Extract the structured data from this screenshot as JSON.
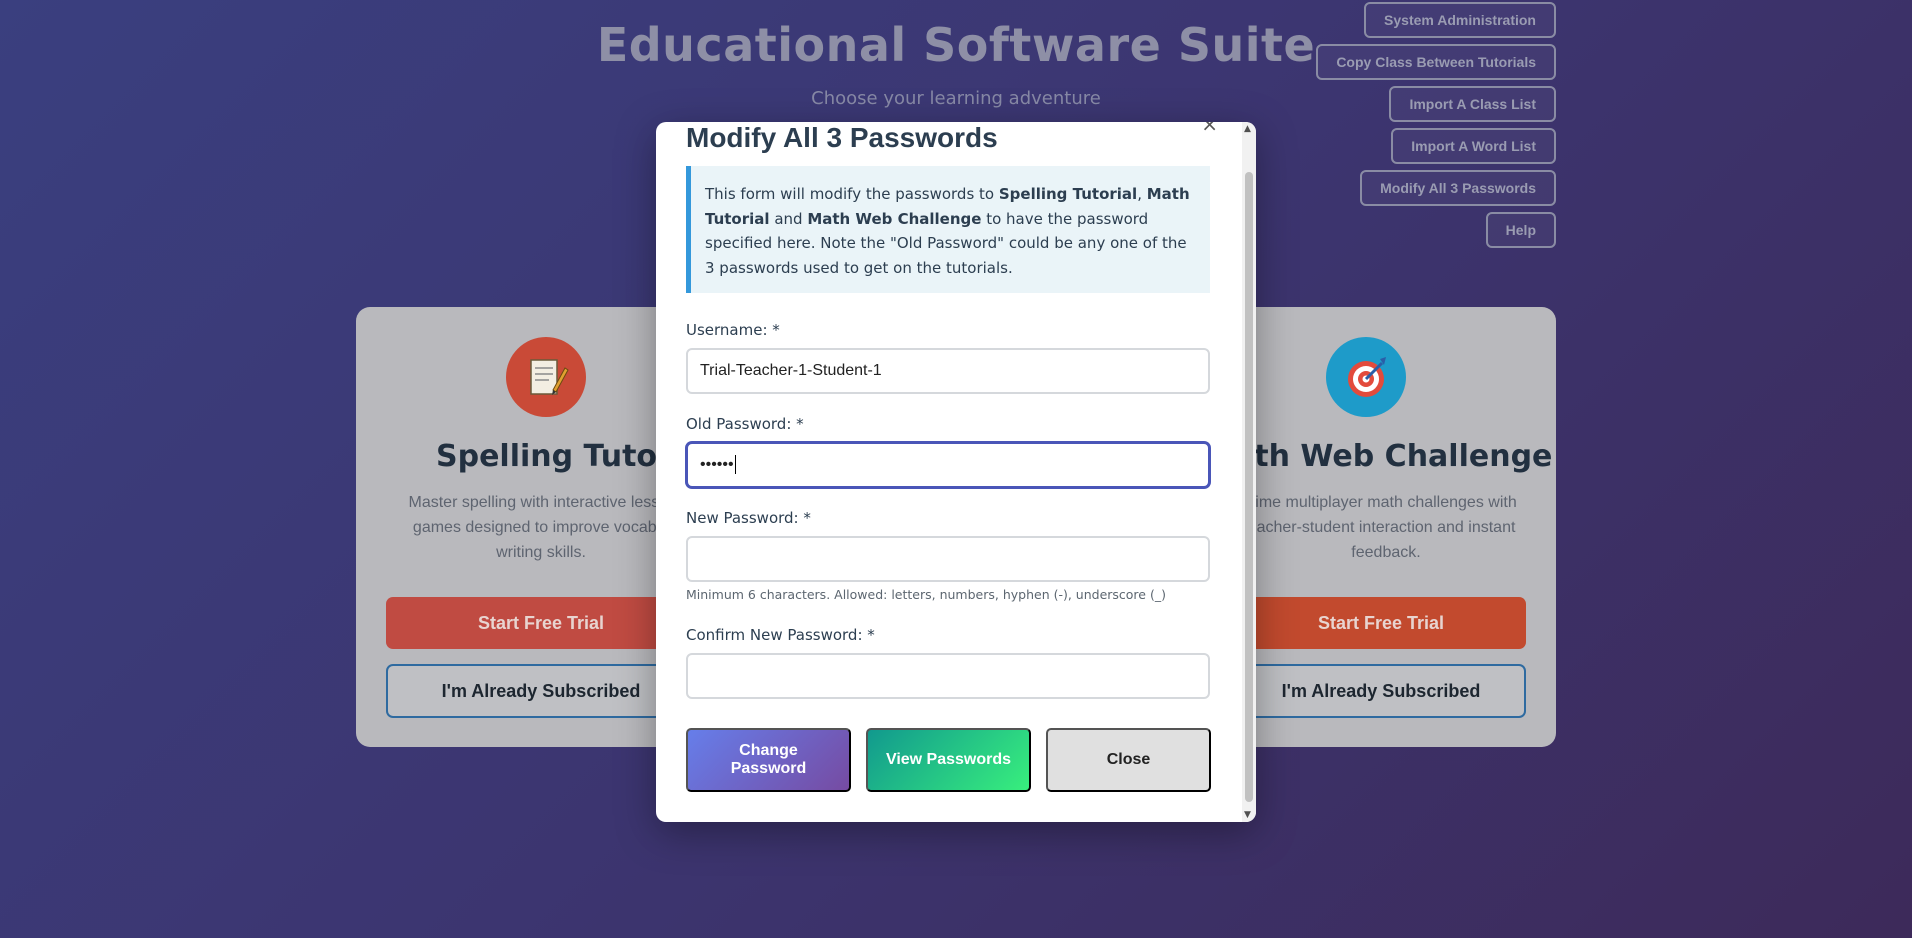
{
  "background": {
    "title": "Educational Software Suite",
    "subtitle": "Choose your learning adventure",
    "admin_nav": [
      {
        "label": "System Administration"
      },
      {
        "label": "Copy Class Between Tutorials"
      },
      {
        "label": "Import A Class List"
      },
      {
        "label": "Import A Word List"
      },
      {
        "label": "Modify All 3 Passwords"
      },
      {
        "label": "Help"
      }
    ],
    "cards": [
      {
        "title": "Spelling Tutorial",
        "icon": "memo-pencil-icon",
        "description": "Master spelling with interactive lessons and games designed to improve vocabulary and writing skills.",
        "description_visible": "Master spelling with interactive lessor\ngames designed to improve vocabul\nwriting skills.",
        "trial_label": "Start Free Trial",
        "subscribed_label": "I'm Already Subscribed"
      },
      {
        "title": "Math Web Challenge",
        "title_visible": "ath Web Challenge",
        "icon": "target-dart-icon",
        "description_visible": "ime multiplayer math challenges with\nacher-student interaction and instant\nfeedback.",
        "trial_label": "Start Free Trial",
        "subscribed_label": "I'm Already Subscribed"
      }
    ]
  },
  "modal": {
    "close_glyph": "×",
    "title": "Modify All 3 Passwords",
    "info": {
      "t1": "This form will modify the passwords to ",
      "b1": "Spelling Tutorial",
      "t2": ", ",
      "b2": "Math Tutorial",
      "t3": " and ",
      "b3": "Math Web Challenge",
      "t4": " to have the password specified here. Note the \"Old Password\" could be any one of the 3 passwords used to get on the tutorials."
    },
    "username": {
      "label": "Username: *",
      "value": "Trial-Teacher-1-Student-1"
    },
    "old_password": {
      "label": "Old Password: *",
      "masked_value": "••••••"
    },
    "new_password": {
      "label": "New Password: *",
      "value": ""
    },
    "hint": "Minimum 6 characters. Allowed: letters, numbers, hyphen (-), underscore (_)",
    "confirm_password": {
      "label": "Confirm New Password: *",
      "value": ""
    },
    "buttons": {
      "change": "Change Password",
      "view": "View Passwords",
      "close": "Close"
    }
  },
  "colors": {
    "accent_purple": "#667eea",
    "accent_green": "#11998e",
    "trial_red": "#c04b42",
    "info_border": "#3498db"
  }
}
